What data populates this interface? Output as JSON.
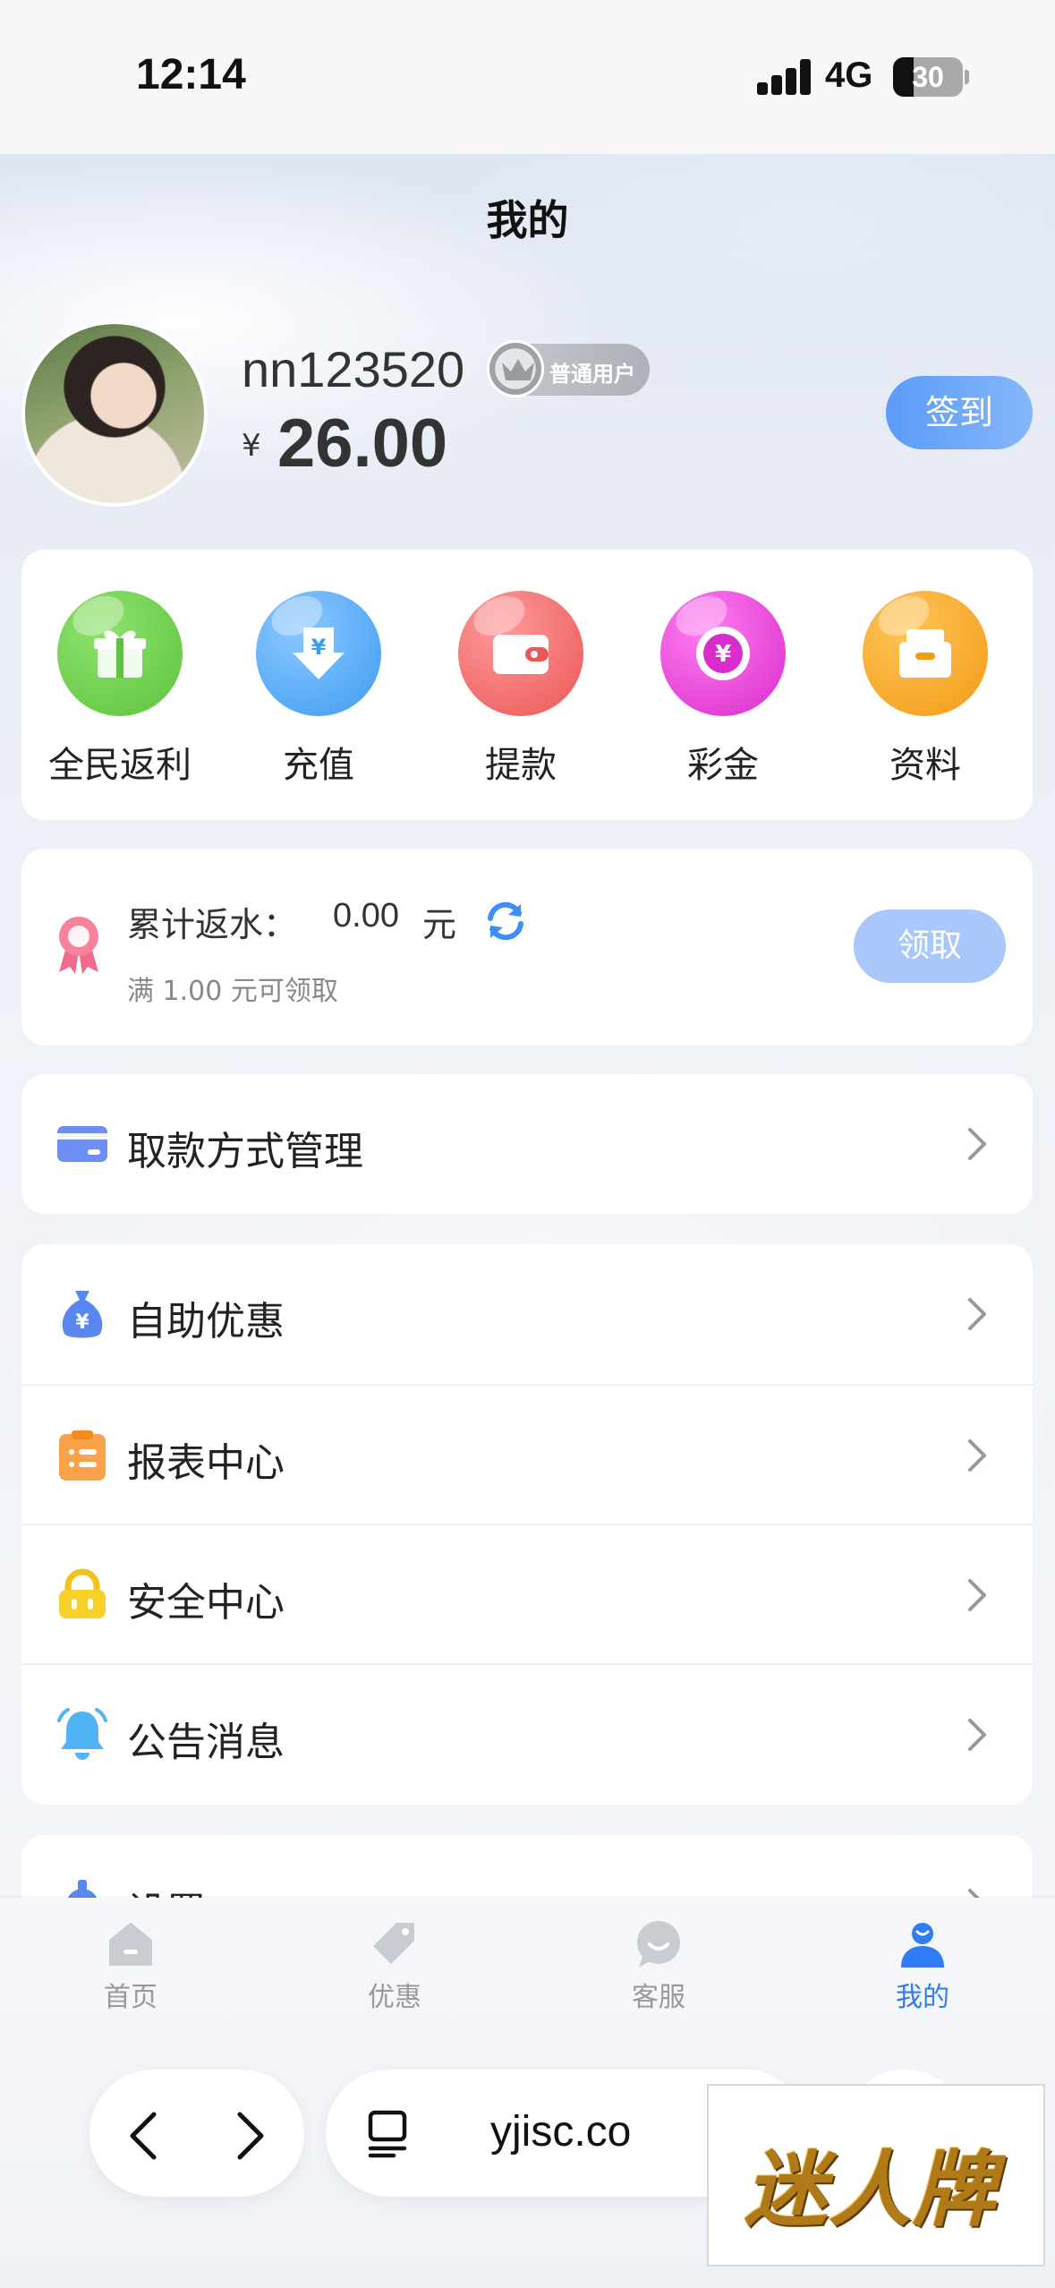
{
  "status_bar": {
    "time": "12:14",
    "network": "4G",
    "battery": "30"
  },
  "header": {
    "title": "我的"
  },
  "profile": {
    "username": "nn123520",
    "badge": "普通用户",
    "currency_symbol": "¥",
    "balance": "26.00",
    "signin_label": "签到"
  },
  "quick_actions": [
    {
      "label": "全民返利",
      "icon": "gift-icon",
      "color": "#6fd052"
    },
    {
      "label": "充值",
      "icon": "deposit-icon",
      "color": "#4da8f7"
    },
    {
      "label": "提款",
      "icon": "wallet-icon",
      "color": "#f26a6a"
    },
    {
      "label": "彩金",
      "icon": "bonus-coin-icon",
      "color": "#e94ad8"
    },
    {
      "label": "资料",
      "icon": "box-icon",
      "color": "#f5a623"
    }
  ],
  "rebate": {
    "label": "累计返水：",
    "amount": "0.00",
    "unit": "元",
    "hint": "满 1.00 元可领取",
    "claim_label": "领取"
  },
  "payment": {
    "label": "取款方式管理"
  },
  "menu": [
    {
      "label": "自助优惠",
      "icon": "money-bag-icon"
    },
    {
      "label": "报表中心",
      "icon": "clipboard-icon"
    },
    {
      "label": "安全中心",
      "icon": "lock-icon"
    },
    {
      "label": "公告消息",
      "icon": "bell-icon"
    }
  ],
  "settings": {
    "label": "设置"
  },
  "tabbar": [
    {
      "label": "首页",
      "icon": "home-icon"
    },
    {
      "label": "优惠",
      "icon": "tag-icon"
    },
    {
      "label": "客服",
      "icon": "chat-icon"
    },
    {
      "label": "我的",
      "icon": "user-icon",
      "active": true
    }
  ],
  "browser": {
    "url": "yjisc.co"
  },
  "watermark": {
    "text": "迷人牌"
  }
}
